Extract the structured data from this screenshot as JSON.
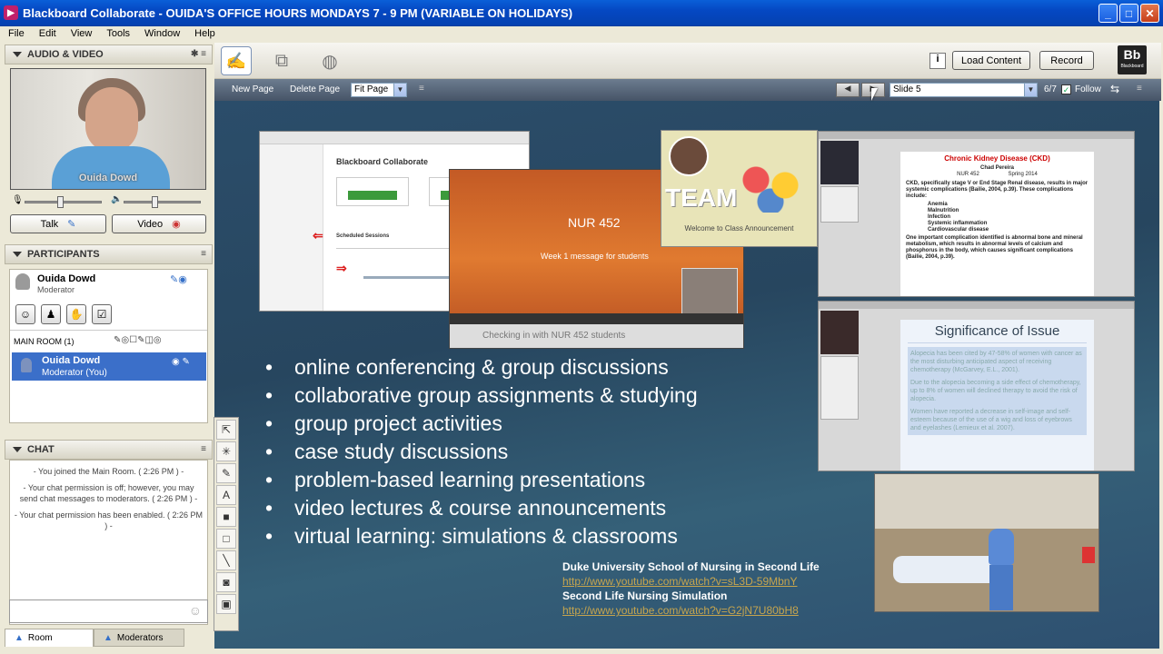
{
  "window": {
    "title": "Blackboard Collaborate - OUIDA'S OFFICE HOURS MONDAYS 7 - 9 PM (VARIABLE ON HOLIDAYS)"
  },
  "menu": [
    "File",
    "Edit",
    "View",
    "Tools",
    "Window",
    "Help"
  ],
  "audio_video": {
    "header": "AUDIO & VIDEO",
    "video_caption": "Ouida Dowd",
    "talk_label": "Talk",
    "video_label": "Video"
  },
  "participants": {
    "header": "PARTICIPANTS",
    "self_name": "Ouida Dowd",
    "self_role": "Moderator",
    "room_label": "MAIN ROOM (1)",
    "room_row_name": "Ouida Dowd",
    "room_row_role": "Moderator (You)"
  },
  "chat": {
    "header": "CHAT",
    "messages": [
      "- You joined the Main Room. ( 2:26 PM ) -",
      "- Your chat permission is off; however, you may send chat messages to moderators. ( 2:26 PM ) -",
      "- Your chat permission has been enabled. ( 2:26 PM ) -"
    ]
  },
  "bottom_tabs": {
    "room": "Room",
    "moderators": "Moderators"
  },
  "toolbar": {
    "load_content": "Load Content",
    "record": "Record",
    "new_page": "New Page",
    "delete_page": "Delete Page",
    "fit_page": "Fit Page",
    "slide_select": "Slide 5",
    "slide_count": "6/7",
    "follow": "Follow",
    "bb_logo": "Bb",
    "bb_logo_sub": "Blackboard"
  },
  "slide": {
    "bullets": [
      "online conferencing & group discussions",
      "collaborative group assignments & studying",
      "group project activities",
      "case study discussions",
      "problem-based learning presentations",
      "video lectures & course announcements",
      "virtual learning: simulations & classrooms"
    ],
    "ref1_title": "Duke University School of Nursing in Second Life",
    "ref1_url": "http://www.youtube.com/watch?v=sL3D-59MbnY",
    "ref2_title": "Second Life Nursing Simulation",
    "ref2_url": "http://www.youtube.com/watch?v=G2jN7U80bH8",
    "shot1_header": "Blackboard Collaborate",
    "shot1_sub": "Scheduled Sessions",
    "video_course": "NUR 452",
    "video_msg": "Week 1 message for students",
    "video_caption": "Checking in with NUR 452 students",
    "team_text": "TEAM",
    "team_caption": "Welcome to Class Announcement",
    "ckd_title": "Chronic Kidney Disease (CKD)",
    "ckd_author": "Chad Pereira",
    "ckd_course": "NUR 452",
    "ckd_term": "Spring 2014",
    "ckd_lead": "CKD, specifically stage V or End Stage Renal disease, results in major systemic complications (Bailie, 2004, p.39). These complications include:",
    "ckd_items": [
      "Anemia",
      "Malnutrition",
      "Infection",
      "Systemic inflammation",
      "Cardiovascular disease"
    ],
    "ckd_tail": "One important complication identified is abnormal bone and mineral metabolism, which results in abnormal levels of calcium and phosphorus in the body, which causes significant complications (Bailie, 2004, p.39).",
    "sig_title": "Significance of Issue",
    "sig_items": [
      "Alopecia has been cited by 47-58% of women with cancer as the most disturbing anticipated aspect of receiving chemotherapy (McGarvey, E.L., 2001).",
      "Due to the alopecia becoming a side effect of chemotherapy, up to 8% of women will declined therapy to avoid the risk of alopecia.",
      "Women have reported a decrease in self-image and self-esteem because of the use of a wig and loss of eyebrows and eyelashes (Lemieux et al. 2007)."
    ]
  },
  "colors": {
    "titlebar": "#0548c3",
    "selection": "#3b6fc9",
    "slide_bg": "#2b4d6a",
    "link": "#c6a54e"
  }
}
